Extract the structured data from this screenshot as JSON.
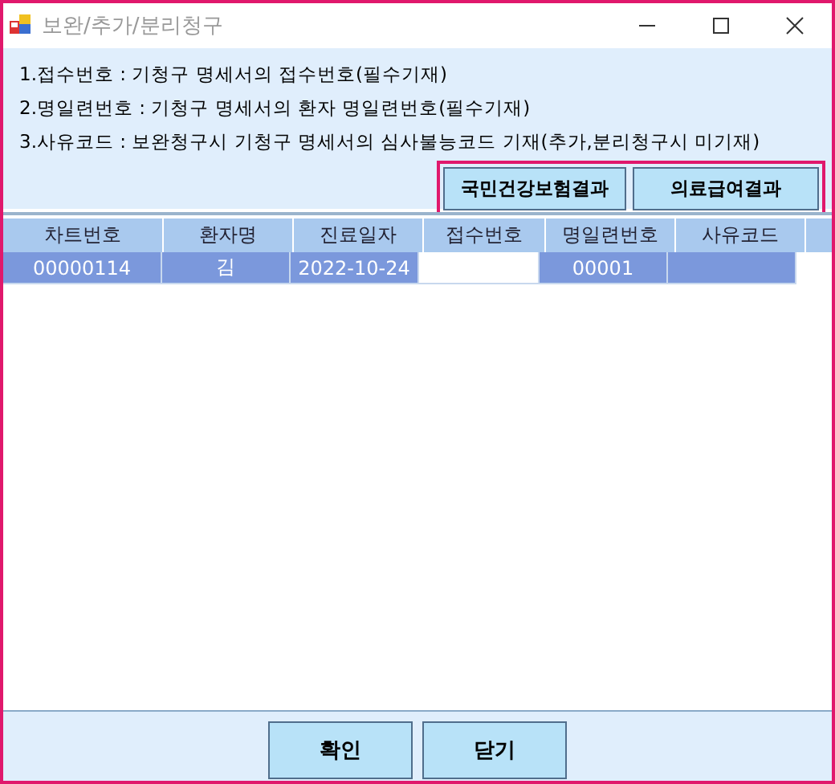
{
  "window": {
    "title": "보완/추가/분리청구"
  },
  "notes": [
    "1.접수번호 : 기청구 명세서의 접수번호(필수기재)",
    "2.명일련번호 : 기청구 명세서의 환자 명일련번호(필수기재)",
    "3.사유코드 : 보완청구시 기청구 명세서의 심사불능코드 기재(추가,분리청구시 미기재)"
  ],
  "result_buttons": {
    "highlighted": true,
    "buttons": [
      "국민건강보험결과",
      "의료급여결과"
    ]
  },
  "table": {
    "columns": [
      "차트번호",
      "환자명",
      "진료일자",
      "접수번호",
      "명일련번호",
      "사유코드"
    ],
    "rows": [
      {
        "selected": true,
        "cells": [
          {
            "text": "00000114",
            "current": false
          },
          {
            "text": "김",
            "current": false
          },
          {
            "text": "2022-10-24",
            "current": false
          },
          {
            "current": true
          },
          {
            "text": "00001",
            "current": false
          },
          {
            "current": false
          }
        ]
      }
    ]
  },
  "buttons": [
    "확인",
    "닫기"
  ]
}
